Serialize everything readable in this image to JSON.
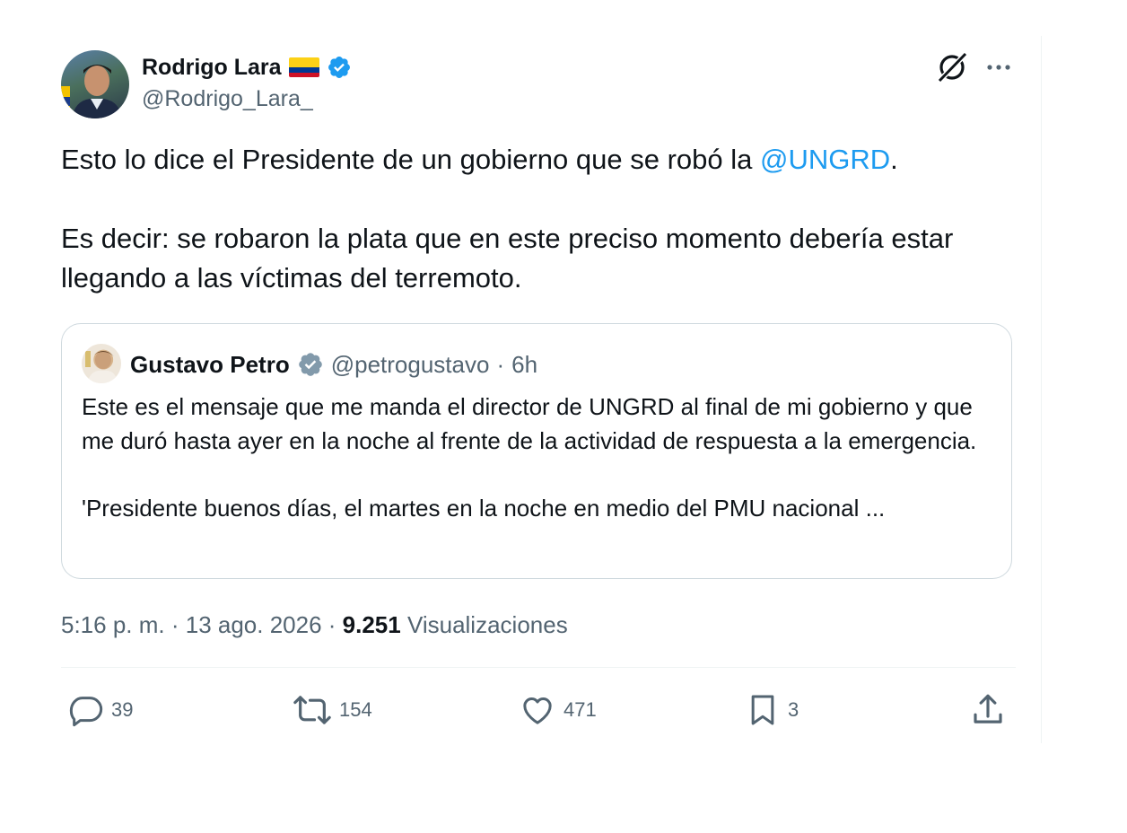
{
  "tweet": {
    "author": {
      "name": "Rodrigo Lara",
      "handle": "@Rodrigo_Lara_"
    },
    "text_line1_before": "Esto lo dice el Presidente de un gobierno que se robó la ",
    "mention": "@UNGRD",
    "text_line1_after": ".",
    "text_para2": "Es decir: se robaron la plata que en este preciso momento debería estar llegando a las víctimas del terremoto.",
    "quoted": {
      "name": "Gustavo Petro",
      "handle": "@petrogustavo",
      "separator": "·",
      "time": "6h",
      "text_para1": "Este es el mensaje que me manda el director de UNGRD al final de mi gobierno y que me duró hasta ayer en la noche al frente de la actividad de respuesta a la emergencia.",
      "text_para2": "'Presidente buenos días, el martes en  la noche en medio del PMU nacional ..."
    },
    "meta": {
      "time": "5:16 p. m.",
      "sep": " · ",
      "date": "13 ago. 2026",
      "views_count": "9.251",
      "views_label": " Visualizaciones"
    },
    "actions": {
      "replies": "39",
      "reposts": "154",
      "likes": "471",
      "bookmarks": "3"
    }
  },
  "colors": {
    "accent": "#1d9bf0",
    "secondary_text": "#536471",
    "primary_text": "#0f1419",
    "border": "#cfd9de",
    "verified_org": "#1d9bf0",
    "verified_gov": "#829aab"
  },
  "icons": [
    "grok-icon",
    "more-icon",
    "verified-badge-icon",
    "reply-icon",
    "repost-icon",
    "like-icon",
    "bookmark-icon",
    "share-icon",
    "colombia-flag-icon"
  ]
}
